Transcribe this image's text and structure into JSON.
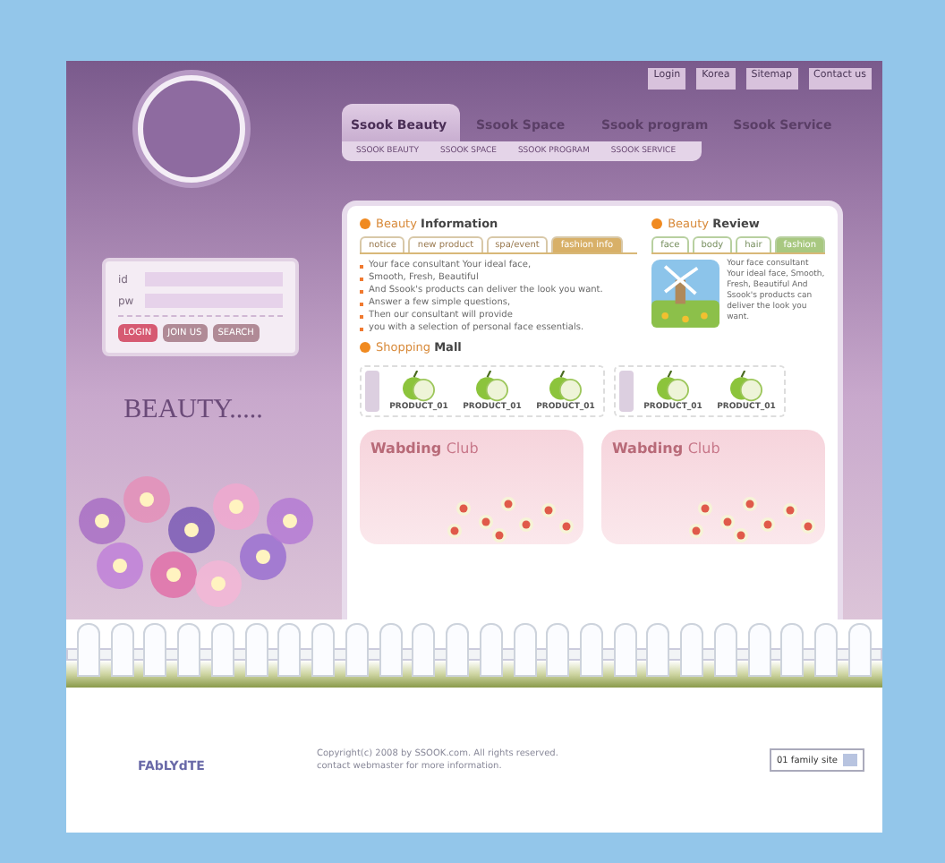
{
  "top_links": [
    "Login",
    "Korea",
    "Sitemap",
    "Contact us"
  ],
  "nav": {
    "tabs": [
      {
        "label": "Ssook Beauty",
        "selected": true
      },
      {
        "label": "Ssook Space",
        "selected": false
      },
      {
        "label": "Ssook program",
        "selected": false
      },
      {
        "label": "Ssook Service",
        "selected": false
      }
    ],
    "subnav": [
      "SSOOK BEAUTY",
      "SSOOK SPACE",
      "SSOOK PROGRAM",
      "SSOOK SERVICE"
    ]
  },
  "login": {
    "fields": [
      {
        "label": "id"
      },
      {
        "label": "pw"
      }
    ],
    "buttons": [
      "LOGIN",
      "JOIN US",
      "SEARCH"
    ]
  },
  "sidebar": {
    "heading": "BEAUTY....."
  },
  "info": {
    "title": "Beauty **Information**",
    "tabs": [
      {
        "label": "notice",
        "selected": false
      },
      {
        "label": "new product",
        "selected": false
      },
      {
        "label": "spa/event",
        "selected": false
      },
      {
        "label": "fashion info",
        "selected": true
      }
    ],
    "items": [
      "Your face consultant Your ideal face,",
      "Smooth, Fresh, Beautiful",
      "And Ssook's products can deliver the look you want.",
      "Answer a few simple questions,",
      "Then our consultant will provide",
      "you with a selection of personal face essentials."
    ]
  },
  "review": {
    "title": "Beauty **Review**",
    "tabs": [
      {
        "label": "face",
        "selected": false
      },
      {
        "label": "body",
        "selected": false
      },
      {
        "label": "hair",
        "selected": false
      },
      {
        "label": "fashion",
        "selected": true
      }
    ],
    "text": "Your face consultant Your ideal face, Smooth, Fresh, Beautiful And Ssook's products can deliver the look you want."
  },
  "shopping": {
    "title": "Shopping **Mall**",
    "groups": [
      [
        "PRODUCT_01",
        "PRODUCT_01",
        "PRODUCT_01"
      ],
      [
        "PRODUCT_01",
        "PRODUCT_01"
      ]
    ]
  },
  "clubs": [
    {
      "title": "Wabding",
      "title_light": "Club"
    },
    {
      "title": "Wabding",
      "title_light": "Club"
    }
  ],
  "footer": {
    "logo": "FAbLYdTE",
    "copyright": "Copyright(c) 2008 by SSOOK.com. All rights reserved.",
    "contact": "contact webmaster for more information.",
    "family_site": "01 family site"
  }
}
